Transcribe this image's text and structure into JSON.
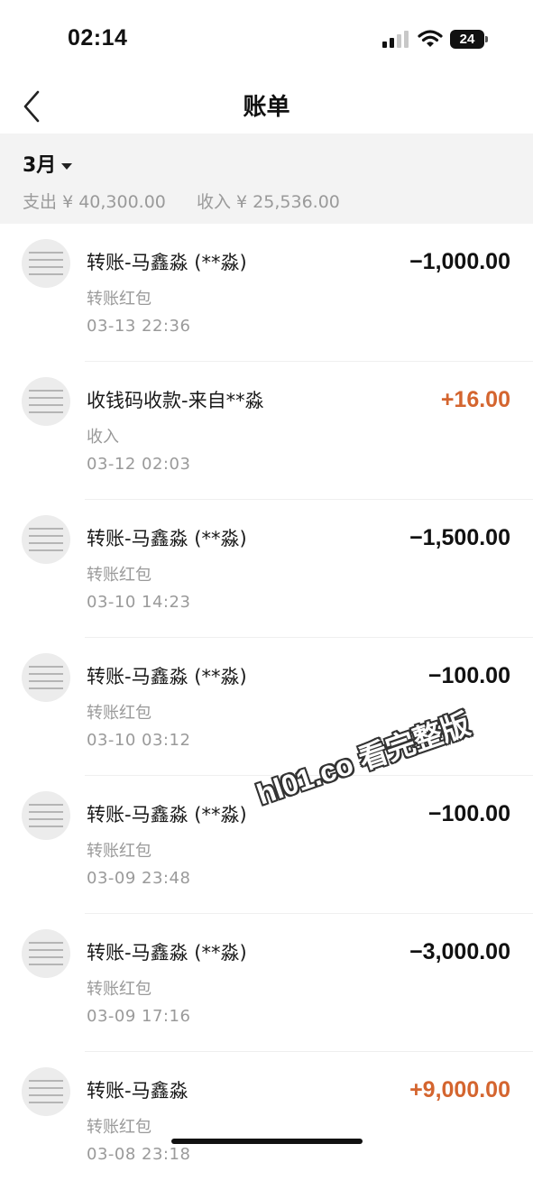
{
  "status_bar": {
    "time": "02:14",
    "battery": "24"
  },
  "nav": {
    "title": "账单",
    "back_icon": "chevron-left-icon"
  },
  "summary": {
    "month": "3月",
    "expense_label": "支出",
    "expense": "¥ 40,300.00",
    "income_label": "收入",
    "income": "¥ 25,536.00"
  },
  "colors": {
    "income_amount": "#d4652f",
    "summary_bg": "#f3f3f3"
  },
  "transactions": [
    {
      "title": "转账-马鑫淼 (**淼)",
      "category": "转账红包",
      "date": "03-13  22:36",
      "amount": "−1,000.00",
      "direction": "out"
    },
    {
      "title": "收钱码收款-来自**淼",
      "category": "收入",
      "date": "03-12  02:03",
      "amount": "+16.00",
      "direction": "in"
    },
    {
      "title": "转账-马鑫淼 (**淼)",
      "category": "转账红包",
      "date": "03-10  14:23",
      "amount": "−1,500.00",
      "direction": "out"
    },
    {
      "title": "转账-马鑫淼 (**淼)",
      "category": "转账红包",
      "date": "03-10  03:12",
      "amount": "−100.00",
      "direction": "out"
    },
    {
      "title": "转账-马鑫淼 (**淼)",
      "category": "转账红包",
      "date": "03-09  23:48",
      "amount": "−100.00",
      "direction": "out"
    },
    {
      "title": "转账-马鑫淼 (**淼)",
      "category": "转账红包",
      "date": "03-09  17:16",
      "amount": "−3,000.00",
      "direction": "out"
    },
    {
      "title": "转账-马鑫淼",
      "category": "转账红包",
      "date": "03-08  23:18",
      "amount": "+9,000.00",
      "direction": "in"
    }
  ],
  "watermark": "hl01.co 看完整版"
}
